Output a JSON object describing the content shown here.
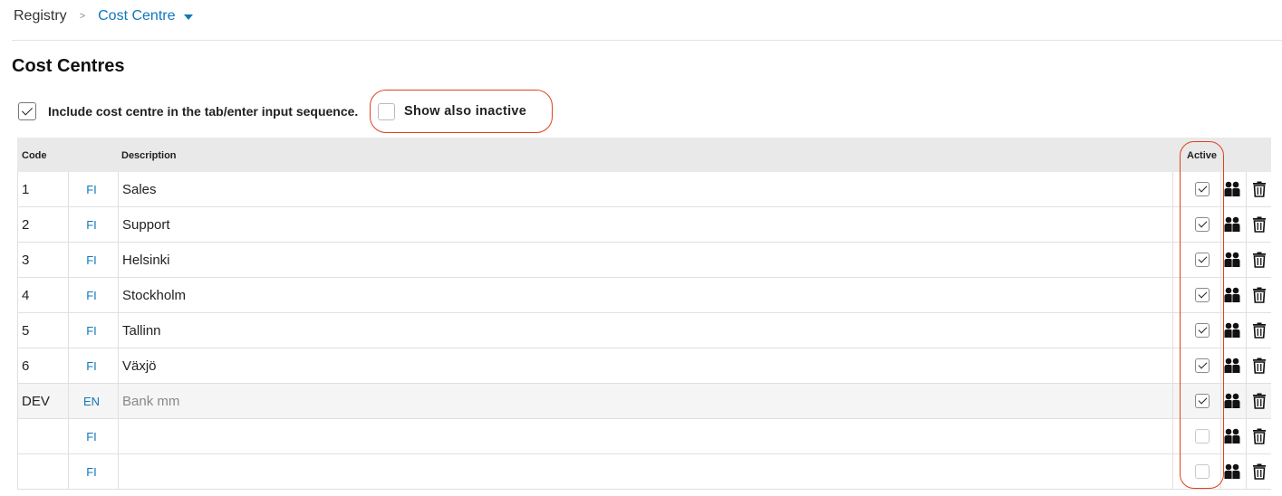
{
  "breadcrumb": {
    "root": "Registry",
    "separator": ">",
    "current": "Cost Centre"
  },
  "page_title": "Cost Centres",
  "options": {
    "include_tab_sequence": {
      "label": "Include cost centre in the tab/enter input sequence.",
      "checked": true
    },
    "show_inactive": {
      "label": "Show also inactive",
      "checked": false
    }
  },
  "table": {
    "headers": {
      "code": "Code",
      "language": "",
      "description": "Description",
      "active": "Active"
    },
    "rows": [
      {
        "code": "1",
        "lang": "FI",
        "description": "Sales",
        "active": true
      },
      {
        "code": "2",
        "lang": "FI",
        "description": "Support",
        "active": true
      },
      {
        "code": "3",
        "lang": "FI",
        "description": "Helsinki",
        "active": true
      },
      {
        "code": "4",
        "lang": "FI",
        "description": "Stockholm",
        "active": true
      },
      {
        "code": "5",
        "lang": "FI",
        "description": "Tallinn",
        "active": true
      },
      {
        "code": "6",
        "lang": "FI",
        "description": "Växjö",
        "active": true
      },
      {
        "code": "DEV",
        "lang": "EN",
        "description": "Bank mm",
        "active": true,
        "muted": true
      },
      {
        "code": "",
        "lang": "FI",
        "description": "",
        "active": false
      },
      {
        "code": "",
        "lang": "FI",
        "description": "",
        "active": false
      }
    ]
  },
  "icons": {
    "users": "users-icon",
    "delete": "trash-icon",
    "dropdown": "caret-down-icon"
  },
  "colors": {
    "link": "#1177bb",
    "highlight": "#e2411b",
    "header_bg": "#e9e9e9"
  }
}
